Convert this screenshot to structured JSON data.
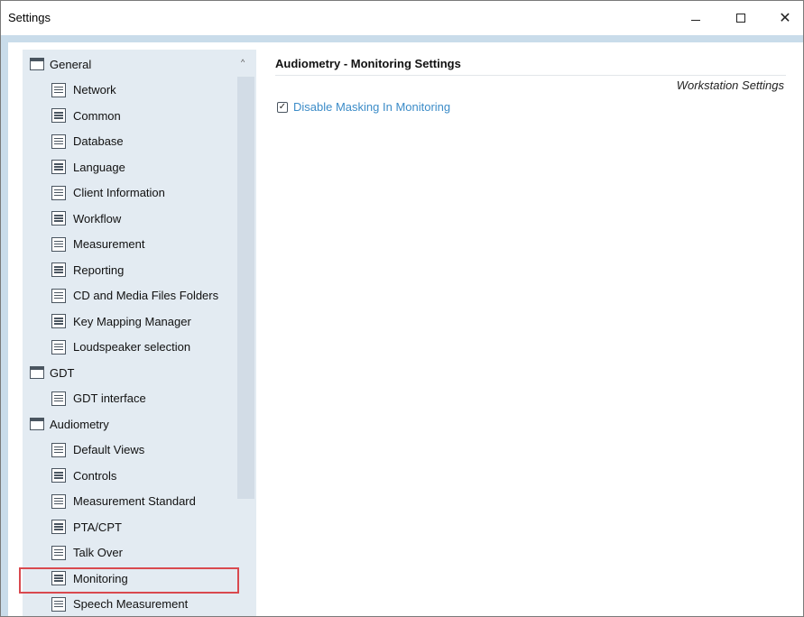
{
  "window": {
    "title": "Settings",
    "controls": {
      "minimize": "minimize",
      "maximize": "maximize",
      "close": "✕"
    }
  },
  "sidebar": {
    "groups": [
      {
        "label": "General",
        "items": [
          "Network",
          "Common",
          "Database",
          "Language",
          "Client Information",
          "Workflow",
          "Measurement",
          "Reporting",
          "CD and Media Files Folders",
          "Key Mapping Manager",
          "Loudspeaker selection"
        ]
      },
      {
        "label": "GDT",
        "items": [
          "GDT interface"
        ]
      },
      {
        "label": "Audiometry",
        "items": [
          "Default Views",
          "Controls",
          "Measurement Standard",
          "PTA/CPT",
          "Talk Over",
          "Monitoring",
          "Speech Measurement"
        ]
      }
    ],
    "selected": "Monitoring",
    "scroll_up_arrow": "^"
  },
  "content": {
    "title": "Audiometry - Monitoring Settings",
    "group_label": "Workstation Settings",
    "checkbox": {
      "label": "Disable Masking In Monitoring",
      "checked": true,
      "mark": "✓"
    }
  },
  "colors": {
    "accent_blue": "#3c8cc8",
    "selection_border": "#d9494f",
    "sidebar_bg": "#e3ebf2",
    "band": "#c9dcea"
  }
}
